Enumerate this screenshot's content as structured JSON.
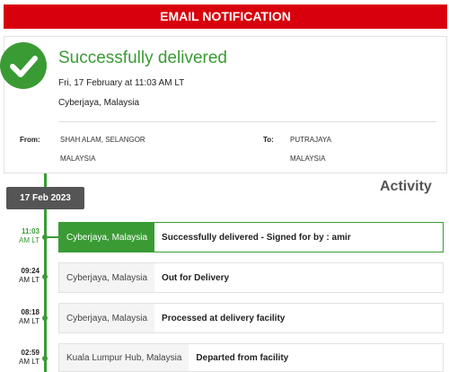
{
  "header": {
    "title": "EMAIL NOTIFICATION"
  },
  "summary": {
    "status": "Successfully delivered",
    "datetime": "Fri, 17 February at 11:03 AM LT",
    "location": "Cyberjaya, Malaysia",
    "from_label": "From:",
    "from_line1": "SHAH ALAM, SELANGOR",
    "from_line2": "MALAYSIA",
    "to_label": "To:",
    "to_line1": "PUTRAJAYA",
    "to_line2": "MALAYSIA"
  },
  "activity": {
    "title": "Activity",
    "date": "17 Feb 2023",
    "events": [
      {
        "time": "11:03",
        "zone": "AM LT",
        "location": "Cyberjaya, Malaysia",
        "description": "Successfully delivered - Signed for by : amir"
      },
      {
        "time": "09:24",
        "zone": "AM LT",
        "location": "Cyberjaya, Malaysia",
        "description": "Out for Delivery"
      },
      {
        "time": "08:18",
        "zone": "AM LT",
        "location": "Cyberjaya, Malaysia",
        "description": "Processed at delivery facility"
      },
      {
        "time": "02:59",
        "zone": "AM LT",
        "location": "Kuala Lumpur Hub, Malaysia",
        "description": "Departed from facility"
      }
    ]
  },
  "colors": {
    "brand_red": "#d8000c",
    "success_green": "#3a9b35",
    "badge_gray": "#555555"
  },
  "icons": {
    "status": "checkmark-icon"
  }
}
